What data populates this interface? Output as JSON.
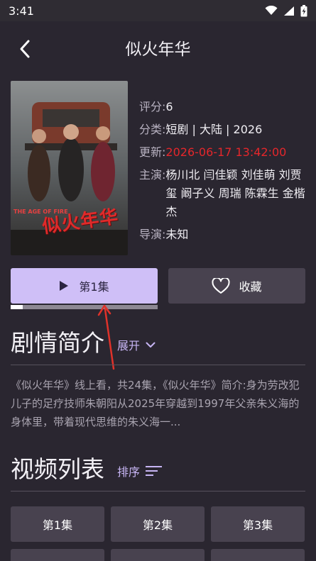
{
  "status_bar": {
    "time": "3:41",
    "icons": [
      "wifi-icon",
      "signal-icon",
      "battery-charging-icon"
    ]
  },
  "header": {
    "title": "似火年华",
    "back_icon": "chevron-left-icon"
  },
  "poster": {
    "title_art": "似火年华",
    "subtitle_art": "THE AGE OF FIRE"
  },
  "info": {
    "rating_label": "评分:",
    "rating_value": "6",
    "category_label": "分类:",
    "category_value": "短剧 | 大陆 | 2026",
    "updated_label": "更新:",
    "updated_value": "2026-06-17 13:42:00",
    "cast_label": "主演:",
    "cast_value": "杨川北 闫佳颖 刘佳萌 刘贾玺 阚子义 周瑞 陈霖生 金楷杰",
    "director_label": "导演:",
    "director_value": "未知"
  },
  "actions": {
    "play_label": "第1集",
    "favorite_label": "收藏",
    "progress_fraction": 0.08
  },
  "synopsis": {
    "title": "剧情简介",
    "expand_label": "展开",
    "text": "《似火年华》线上看，共24集，《似火年华》简介:身为劳改犯儿子的足疗技师朱朝阳从2025年穿越到1997年父亲朱义海的身体里，带着现代思维的朱义海一..."
  },
  "video_list": {
    "title": "视频列表",
    "sort_label": "排序",
    "episodes": [
      "第1集",
      "第2集",
      "第3集"
    ]
  },
  "colors": {
    "background": "#2a2630",
    "accent": "#cfbff7",
    "accent_text": "#c7b5f4",
    "update_red": "#e5262b",
    "button_dark": "#48424f"
  }
}
